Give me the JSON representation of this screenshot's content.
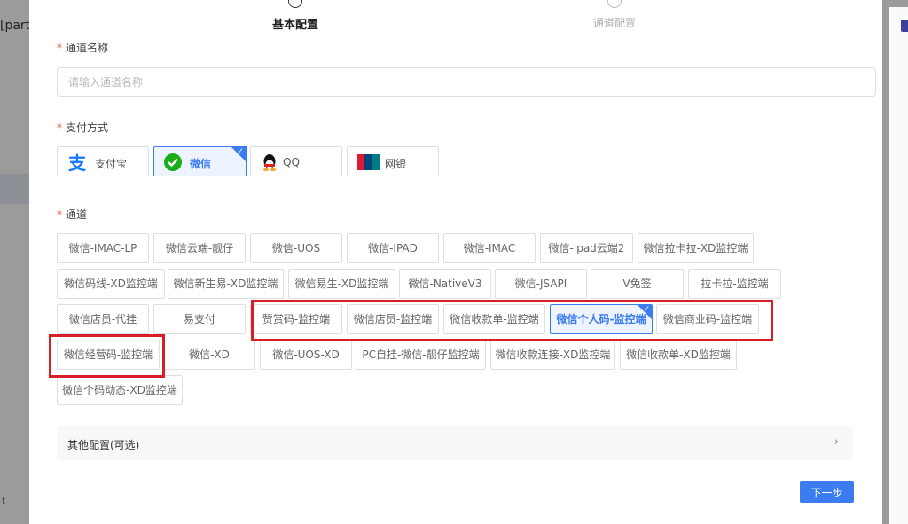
{
  "background": {
    "left_text": "[partial]支付",
    "left_mark": "t"
  },
  "steps": [
    {
      "label": "基本配置",
      "active": true
    },
    {
      "label": "通道配置",
      "active": false
    }
  ],
  "form": {
    "channel_name_label": "通道名称",
    "channel_name_placeholder": "请输入通道名称",
    "channel_name_value": "",
    "payment_label": "支付方式",
    "channel_label": "通道",
    "required_mark": "*"
  },
  "payment_methods": [
    {
      "label": "支付宝",
      "icon": "alipay-icon",
      "selected": false
    },
    {
      "label": "微信",
      "icon": "wechat-icon",
      "selected": true
    },
    {
      "label": "QQ",
      "icon": "qq-icon",
      "selected": false
    },
    {
      "label": "网银",
      "icon": "unionpay-icon",
      "selected": false
    }
  ],
  "channels": [
    {
      "label": "微信-IMAC-LP",
      "selected": false
    },
    {
      "label": "微信云端-靓仔",
      "selected": false
    },
    {
      "label": "微信-UOS",
      "selected": false
    },
    {
      "label": "微信-IPAD",
      "selected": false
    },
    {
      "label": "微信-IMAC",
      "selected": false
    },
    {
      "label": "微信-ipad云端2",
      "selected": false
    },
    {
      "label": "微信拉卡拉-XD监控端",
      "selected": false
    },
    {
      "label": "微信码线-XD监控端",
      "selected": false
    },
    {
      "label": "微信新生易-XD监控端",
      "selected": false
    },
    {
      "label": "微信易生-XD监控端",
      "selected": false
    },
    {
      "label": "微信-NativeV3",
      "selected": false
    },
    {
      "label": "微信-JSAPI",
      "selected": false
    },
    {
      "label": "V免签",
      "selected": false
    },
    {
      "label": "拉卡拉-监控端",
      "selected": false
    },
    {
      "label": "微信店员-代挂",
      "selected": false
    },
    {
      "label": "易支付",
      "selected": false
    },
    {
      "label": "赞赏码-监控端",
      "selected": false
    },
    {
      "label": "微信店员-监控端",
      "selected": false
    },
    {
      "label": "微信收款单-监控端",
      "selected": false
    },
    {
      "label": "微信个人码-监控端",
      "selected": true
    },
    {
      "label": "微信商业码-监控端",
      "selected": false
    },
    {
      "label": "微信经营码-监控端",
      "selected": false
    },
    {
      "label": "微信-XD",
      "selected": false
    },
    {
      "label": "微信-UOS-XD",
      "selected": false
    },
    {
      "label": "PC自挂-微信-靓仔监控端",
      "selected": false
    },
    {
      "label": "微信收款连接-XD监控端",
      "selected": false
    },
    {
      "label": "微信收款单-XD监控端",
      "selected": false
    },
    {
      "label": "微信个码动态-XD监控端",
      "selected": false
    }
  ],
  "other_config": {
    "label": "其他配置(可选)"
  },
  "next_button": {
    "label": "下一步"
  },
  "colors": {
    "accent": "#3b7cf0",
    "required": "#e74c3c",
    "highlight_box": "#d91e26"
  }
}
